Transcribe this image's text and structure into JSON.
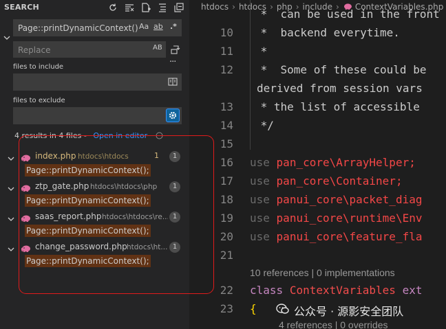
{
  "sidebar": {
    "title": "SEARCH",
    "search_value": "Page::printDynamicContext()",
    "opt_case": "Aa",
    "opt_word": "ab",
    "opt_regex": ".*",
    "replace_placeholder": "Replace",
    "replace_opt": "AB",
    "include_label": "files to include",
    "exclude_label": "files to exclude",
    "results_summary": "4 results in 4 files - ",
    "open_in_editor": "Open in editor",
    "results": [
      {
        "file": "index.php",
        "path": "htdocs\\htdocs",
        "modified": "1",
        "count": "1",
        "match": "Page::printDynamicContext();"
      },
      {
        "file": "ztp_gate.php",
        "path": "htdocs\\htdocs\\php",
        "modified": "",
        "count": "1",
        "match": "Page::printDynamicContext();"
      },
      {
        "file": "saas_report.php",
        "path": "htdocs\\htdocs\\re...",
        "modified": "",
        "count": "1",
        "match": "Page::printDynamicContext();"
      },
      {
        "file": "change_password.php",
        "path": "htdocs\\ht...",
        "modified": "",
        "count": "1",
        "match": "Page::printDynamicContext();"
      }
    ]
  },
  "editor": {
    "breadcrumb": [
      "htdocs",
      "htdocs",
      "php",
      "include",
      "ContextVariables.php"
    ],
    "lines": [
      {
        "n": "",
        "t": " *  can be used in the front"
      },
      {
        "n": "10",
        "t": " *  backend everytime."
      },
      {
        "n": "11",
        "t": " *"
      },
      {
        "n": "12",
        "t": " *  Some of these could be"
      },
      {
        "n": "",
        "t": "derived from session vars"
      },
      {
        "n": "13",
        "t": " * the list of accessible"
      },
      {
        "n": "14",
        "t": " */"
      },
      {
        "n": "15",
        "t": ""
      }
    ],
    "use_lines": [
      {
        "n": "16",
        "kw": "use",
        "ns": "pan_core\\ArrayHelper;"
      },
      {
        "n": "17",
        "kw": "use",
        "ns": "pan_core\\Container;"
      },
      {
        "n": "18",
        "kw": "use",
        "ns": "panui_core\\packet_diag"
      },
      {
        "n": "19",
        "kw": "use",
        "ns": "panui_core\\runtime\\Env"
      },
      {
        "n": "20",
        "kw": "use",
        "ns": "panui_core\\feature_fla"
      }
    ],
    "line21": "21",
    "lens1": "10 references | 0 implementations",
    "line22": "22",
    "class_kw": "class",
    "class_name": "ContextVariables",
    "class_ext": "ext",
    "line23": "23",
    "brace": "{",
    "lens2": "4 references | 0 overrides"
  },
  "watermark": "公众号 · 源影安全团队"
}
